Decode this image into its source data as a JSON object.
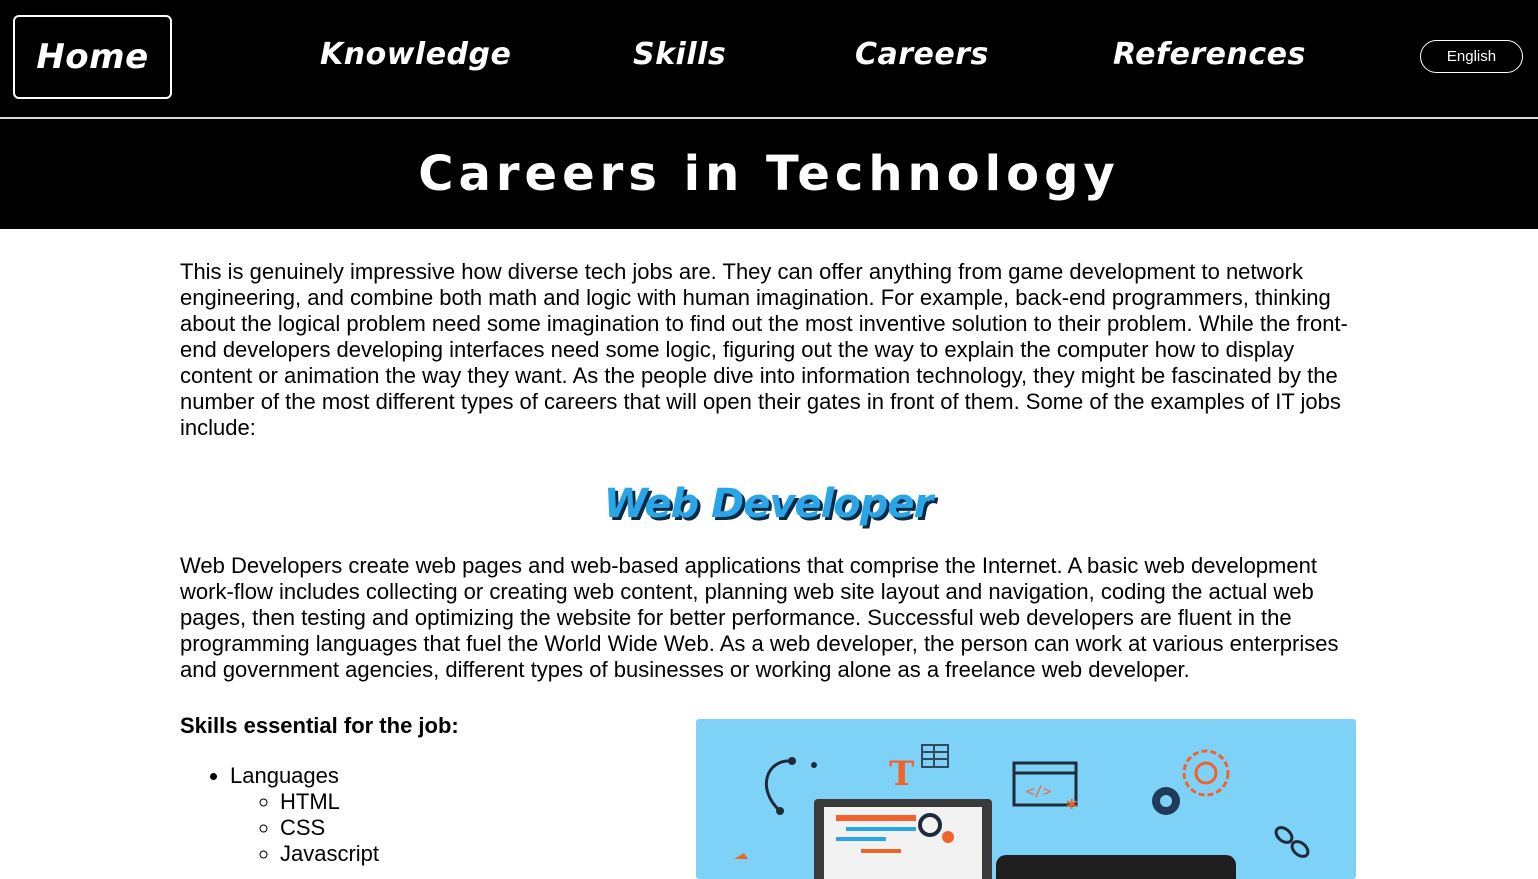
{
  "nav": {
    "home": "Home",
    "knowledge": "Knowledge",
    "skills": "Skills",
    "careers": "Careers",
    "references": "References",
    "language": "English"
  },
  "hero": {
    "title": "Careers in Technology"
  },
  "intro": "This is genuinely impressive how diverse tech jobs are. They can offer anything from game development to network engineering, and combine both math and logic with human imagination. For example, back-end programmers, thinking about the logical problem need some imagination to find out the most inventive solution to their problem. While the front-end developers developing interfaces need some logic, figuring out the way to explain the computer how to display content or animation the way they want. As the people dive into information technology, they might be fascinated by the number of the most different types of careers that will open their gates in front of them. Some of the examples of IT jobs include:",
  "web_developer": {
    "heading": "Web Developer",
    "description": "Web Developers create web pages and web-based applications that comprise the Internet. A basic web development work-flow includes collecting or creating web content, planning web site layout and navigation, coding the actual web pages, then testing and optimizing the website for better performance. Successful web developers are fluent in the programming languages that fuel the World Wide Web. As a web developer, the person can work at various enterprises and government agencies, different types of businesses or working alone as a freelance web developer.",
    "skills_title": "Skills essential for the job:",
    "skills": [
      {
        "label": "Languages",
        "children": [
          "HTML",
          "CSS",
          "Javascript"
        ]
      }
    ],
    "illustration": {
      "background": "#7fd2f7",
      "glyph_t": "T",
      "glyph_code": "</>"
    }
  }
}
